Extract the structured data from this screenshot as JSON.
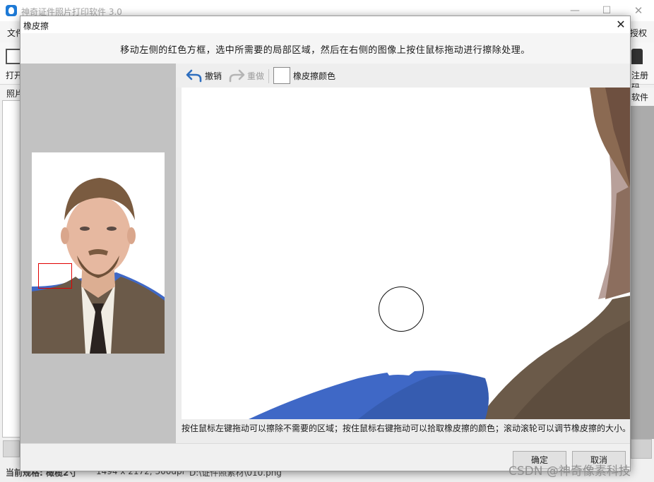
{
  "main_window": {
    "title": "神奇证件照片打印软件 3.0",
    "menu": {
      "file": "文件",
      "auth": "授权"
    },
    "toolbar": {
      "open_label": "打开",
      "register_label": "注册码"
    },
    "left_tab": "照片",
    "right_label": "软件",
    "status": {
      "spec": "当前规格: 橄榄2寸",
      "size": "1494 x 2172, 300dpi",
      "path": "D:\\证件照素材\\010.png"
    },
    "watermark": "CSDN @神奇像素科技"
  },
  "dialog": {
    "title": "橡皮擦",
    "close_symbol": "✕",
    "instruction": "移动左侧的红色方框，选中所需要的局部区域，然后在右侧的图像上按住鼠标拖动进行擦除处理。",
    "toolbar": {
      "undo": "撤销",
      "redo": "重做",
      "eraser_color": "橡皮擦颜色"
    },
    "hint": "按住鼠标左键拖动可以擦除不需要的区域；按住鼠标右键拖动可以拾取橡皮擦的颜色；滚动滚轮可以调节橡皮擦的大小。",
    "buttons": {
      "ok": "确定",
      "cancel": "取消"
    }
  },
  "colors": {
    "selection_box": "#e00000",
    "eraser_swatch": "#ffffff",
    "undo_icon": "#2f6fbf",
    "suit": "#6b5a49",
    "shoulder_blue": "#3f68c6"
  },
  "icons": {
    "undo": "undo-arrow-icon",
    "redo": "redo-arrow-icon",
    "close": "close-icon",
    "app": "app-logo-icon"
  }
}
